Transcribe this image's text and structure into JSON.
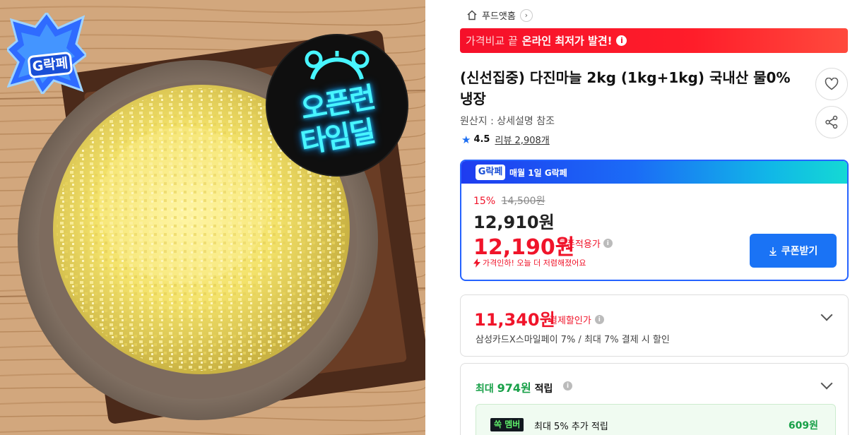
{
  "image": {
    "g_badge": "G락페",
    "openrun_line1": "오픈런",
    "openrun_line2": "타임딜"
  },
  "breadcrumb": {
    "home_icon": "home-icon",
    "label": "푸드앳홈",
    "chevron": "›"
  },
  "promo_banner": {
    "light": "가격비교 끝",
    "strong": "온라인 최저가 발견!",
    "info_icon": "i"
  },
  "product": {
    "title": "(신선집중) 다진마늘 2kg (1kg+1kg) 국내산 물0% 냉장",
    "origin": "원산지 : 상세설명 참조",
    "rating": "4.5",
    "review_text": "리뷰 2,908개"
  },
  "price_box": {
    "header_badge": "G락페",
    "header_text": "매월 1일 G락페",
    "discount_pct": "15%",
    "original_price": "14,500원",
    "sale_price": "12,910원",
    "coupon_price": "12,190원",
    "coupon_note": "쿠폰적용가",
    "price_drop": "가격인하! 오늘 더 저렴해졌어요",
    "coupon_button": "쿠폰받기"
  },
  "card_discount": {
    "amount": "11,340원",
    "label": "결제할인가",
    "desc": "삼성카드X스마일페이 7% / 최대 7% 결제 시 할인"
  },
  "points": {
    "prefix": "최대",
    "amount": "974원",
    "suffix": "적립",
    "member_tag": "쏙 멤버",
    "member_text": "최대 5% 추가 적립",
    "member_points": "609원"
  },
  "colors": {
    "accent_red": "#f0142a",
    "accent_blue": "#2563ff",
    "point_green": "#18a048"
  }
}
